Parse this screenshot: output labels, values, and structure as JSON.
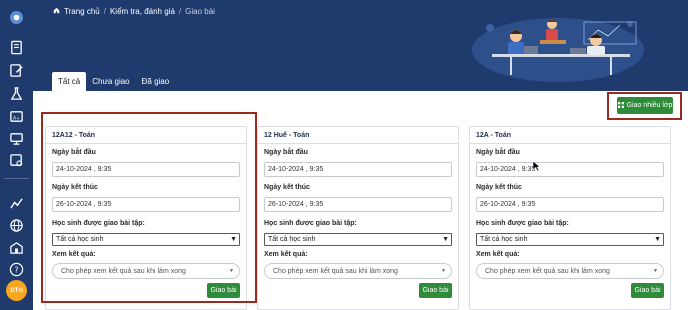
{
  "breadcrumb": {
    "home": "Trang chủ",
    "section": "Kiểm tra, đánh giá",
    "current": "Giao bài"
  },
  "tabs": [
    {
      "label": "Tất cả"
    },
    {
      "label": "Chưa giao"
    },
    {
      "label": "Đã giao"
    }
  ],
  "actions": {
    "assign_multiple_label": "Giao nhiều lớp"
  },
  "sidebar": {
    "avatar_text": "DTH"
  },
  "cards": [
    {
      "title": "12A12 - Toán",
      "start_label": "Ngày bắt đầu",
      "start_value": "24-10-2024 , 9:35",
      "end_label": "Ngày kết thúc",
      "end_value": "26-10-2024 , 9:35",
      "students_label": "Học sinh được giao bài tập:",
      "students_value": "Tất cả học sinh",
      "result_label": "Xem kết quả:",
      "result_value": "Cho phép xem kết quả sau khi làm xong",
      "assign_label": "Giao bài"
    },
    {
      "title": "12 Huế - Toán",
      "start_label": "Ngày bắt đầu",
      "start_value": "24-10-2024 , 9:35",
      "end_label": "Ngày kết thúc",
      "end_value": "26-10-2024 , 9:35",
      "students_label": "Học sinh được giao bài tập:",
      "students_value": "Tất cả học sinh",
      "result_label": "Xem kết quả:",
      "result_value": "Cho phép xem kết quả sau khi làm xong",
      "assign_label": "Giao bài"
    },
    {
      "title": "12A - Toán",
      "start_label": "Ngày bắt đầu",
      "start_value": "24-10-2024 , 9:35",
      "end_label": "Ngày kết thúc",
      "end_value": "26-10-2024 , 9:35",
      "students_label": "Học sinh được giao bài tập:",
      "students_value": "Tất cả học sinh",
      "result_label": "Xem kết quả:",
      "result_value": "Cho phép xem kết quả sau khi làm xong",
      "assign_label": "Giao bài"
    }
  ],
  "colors": {
    "navy": "#1f3a6d",
    "green": "#2e8b3a",
    "highlight": "#9b2a1e"
  }
}
